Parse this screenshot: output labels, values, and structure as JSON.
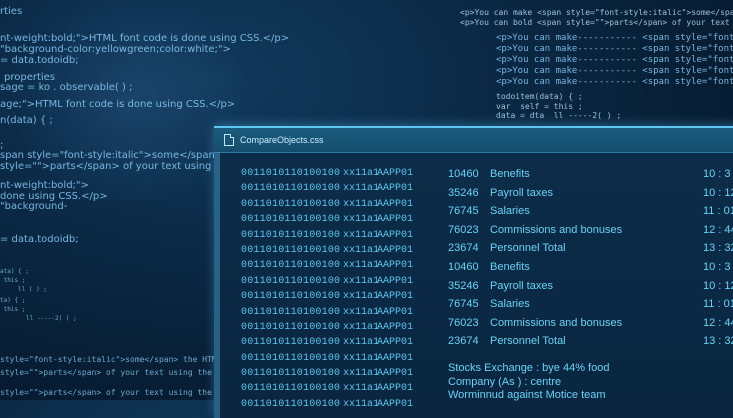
{
  "background": {
    "left_code": [
      "rties",
      "nt-weight:bold;\">HTML font code is done using CSS.</p>",
      "\"background-color:yellowgreen;color:white;\">",
      "= data.todoidb;",
      "properties",
      "sage = ko . observable( ) ;",
      "age;\">HTML font code is done using CSS.</p>",
      "n(data) { ;",
      ";",
      "span style=\"font-style:italic\">some</span> the",
      "style=\"\">parts</span> of your text using the",
      "nt-weight:bold;\">",
      "done using CSS.</p>",
      "\"background-",
      "= data.todoidb;"
    ],
    "left_small": [
      "ata) { ;",
      " this ;",
      "     ll ( ) ;",
      "ta) { ;",
      " this ;",
      "     ll -----2( ) ;"
    ],
    "left_bottom": [
      "style=\"font-style:italic\">some</span> the HTML 'span'",
      "style=\"\">parts</span> of your text using the HTML tag.",
      "style=\"\">parts</span> of your text using the HTML tag."
    ],
    "right_top": [
      "<p>You can make <span style=\"font-style:italic\">some</span> the HTM",
      "<p>You can bold <span style=\"\">parts</span> of your text using the HT"
    ],
    "right_make": [
      "<p>You can make----------- <span style=\"font- a",
      "<p>You can make----------- <span style=\"font- a",
      "<p>You can make----------- <span style=\"font- a",
      "<p>You can make----------- <span style=\"font- a",
      "<p>You can make----------- <span style=\"font- a"
    ],
    "right_code": [
      "todoitem(data) { ;",
      "var  self = this ;",
      "data = dta  ll -----2( ) ;"
    ]
  },
  "window": {
    "title": "CompareObjects.css",
    "binary_rows": [
      [
        "0011010110100100",
        "xx11a1",
        "AAPP01"
      ],
      [
        "0011010110100100",
        "xx11a1",
        "AAPP01"
      ],
      [
        "0011010110100100",
        "xx11a1",
        "AAPP01"
      ],
      [
        "0011010110100100",
        "xx11a1",
        "AAPP01"
      ],
      [
        "0011010110100100",
        "xx11a1",
        "AAPP01"
      ],
      [
        "0011010110100100",
        "xx11a1",
        "AAPP01"
      ],
      [
        "0011010110100100",
        "xx11a1",
        "AAPP01"
      ],
      [
        "0011010110100100",
        "xx11a1",
        "AAPP01"
      ],
      [
        "0011010110100100",
        "xx11a1",
        "AAPP01"
      ],
      [
        "0011010110100100",
        "xx11a1",
        "AAPP01"
      ],
      [
        "0011010110100100",
        "xx11a1",
        "AAPP01"
      ],
      [
        "0011010110100100",
        "xx11a1",
        "AAPP01"
      ],
      [
        "0011010110100100",
        "xx11a1",
        "AAPP01"
      ],
      [
        "0011010110100100",
        "xx11a1",
        "AAPP01"
      ],
      [
        "0011010110100100",
        "xx11a1",
        "AAPP01"
      ],
      [
        "0011010110100100",
        "xx11a1",
        "AAPP01"
      ]
    ],
    "finance_rows": [
      {
        "num": "10460",
        "label": "Benefits",
        "time": "10 : 3"
      },
      {
        "num": "35246",
        "label": "Payroll taxes",
        "time": "10 : 12"
      },
      {
        "num": "76745",
        "label": "Salaries",
        "time": "11 : 01"
      },
      {
        "num": "76023",
        "label": "Commissions and bonuses",
        "time": "12 : 44"
      },
      {
        "num": "23674",
        "label": "Personnel Total",
        "time": "13 : 32"
      },
      {
        "num": "10460",
        "label": "Benefits",
        "time": "10 : 3"
      },
      {
        "num": "35246",
        "label": "Payroll taxes",
        "time": "10 : 12"
      },
      {
        "num": "76745",
        "label": "Salaries",
        "time": "11 : 01"
      },
      {
        "num": "76023",
        "label": "Commissions and bonuses",
        "time": "12 : 44"
      },
      {
        "num": "23674",
        "label": "Personnel Total",
        "time": "13 : 32"
      }
    ],
    "notes": [
      "Stocks Exchange : bye 44% food",
      "Company (As ) : centre",
      "Worminnud  against Motice team"
    ]
  }
}
